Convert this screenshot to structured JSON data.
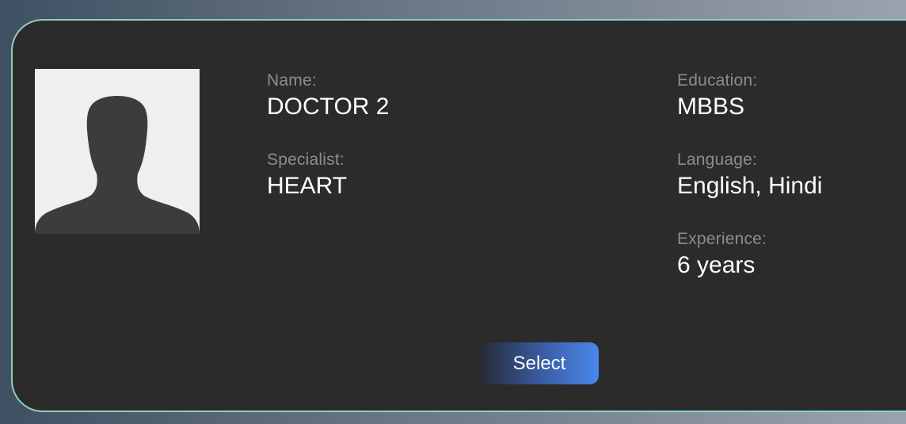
{
  "doctor": {
    "name_label": "Name:",
    "name": "DOCTOR 2",
    "specialist_label": "Specialist:",
    "specialist": "HEART",
    "education_label": "Education:",
    "education": "MBBS",
    "language_label": "Language:",
    "language": "English, Hindi",
    "experience_label": "Experience:",
    "experience": "6 years",
    "avatar_icon": "user-silhouette-icon"
  },
  "actions": {
    "select_label": "Select"
  },
  "colors": {
    "card_background": "#2b2b2b",
    "card_border": "#8fcfbf",
    "label": "#8d8d8d",
    "value": "#ffffff",
    "button_gradient_end": "#4a88ea"
  }
}
